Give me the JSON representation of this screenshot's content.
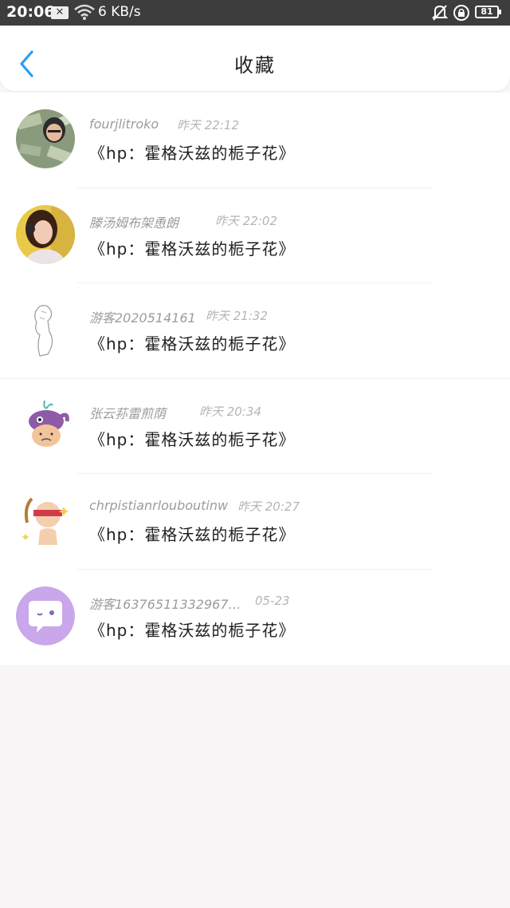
{
  "status_bar": {
    "time": "20:06",
    "notif_glyph": "✕",
    "speed": "6 KB/s",
    "battery": "81",
    "icons": [
      "notification-x-icon",
      "wifi-icon",
      "bell-off-icon",
      "rotation-lock-icon",
      "battery-icon"
    ]
  },
  "header": {
    "back_icon": "chevron-left-icon",
    "title": "收藏",
    "accent": "#2a9df4"
  },
  "items": [
    {
      "name": "fourjlitroko",
      "time": "昨天 22:12",
      "book": "《hp：霍格沃兹的栀子花》"
    },
    {
      "name": "滕汤姆布架恿朗",
      "time": "昨天 22:02",
      "book": "《hp：霍格沃兹的栀子花》"
    },
    {
      "name": "游客2020514161",
      "time": "昨天 21:32",
      "book": "《hp：霍格沃兹的栀子花》"
    },
    {
      "name": "张云荪雷煎荫",
      "time": "昨天 20:34",
      "book": "《hp：霍格沃兹的栀子花》"
    },
    {
      "name": "chrpistianrlouboutinw",
      "time": "昨天 20:27",
      "book": "《hp：霍格沃兹的栀子花》"
    },
    {
      "name": "游客16376511332967…",
      "time": "05-23",
      "book": "《hp：霍格沃兹的栀子花》"
    }
  ]
}
